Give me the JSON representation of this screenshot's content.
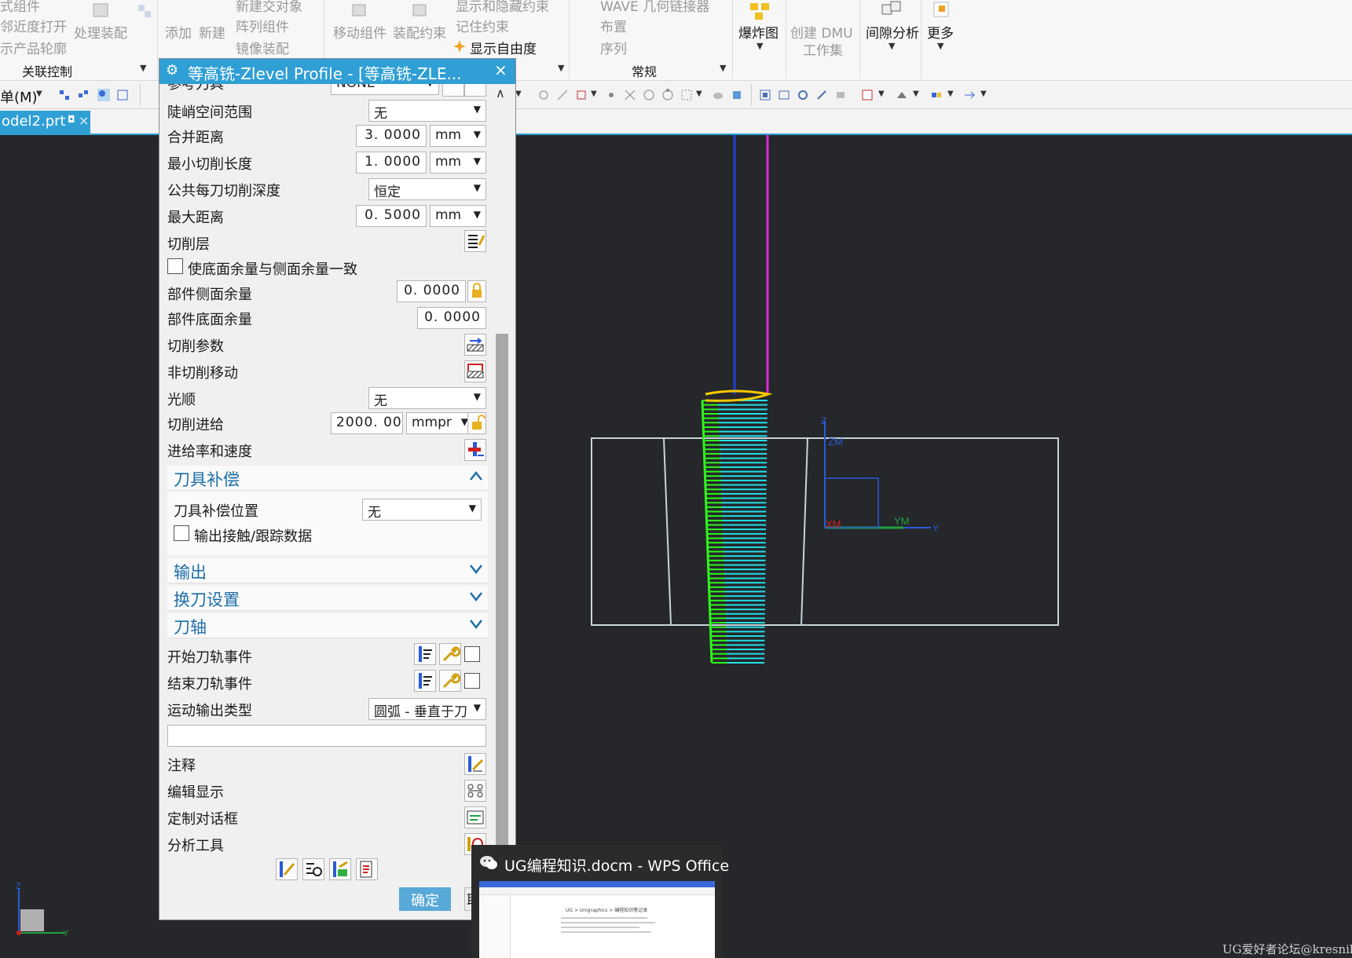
{
  "ribbon": {
    "left_items": [
      "式组件",
      "邻近度打开",
      "示产品轮廓"
    ],
    "process_assembly": "处理装配",
    "add": "添加",
    "new": "新建",
    "new_interaction_object": "新建交对象",
    "array_component": "阵列组件",
    "mirror_assembly": "镜像装配",
    "move_component": "移动组件",
    "assembly_constraint": "装配约束",
    "show_hide_constraint": "显示和隐藏约束",
    "remember_constraint": "记住约束",
    "show_dof": "显示自由度",
    "wave_linker": "WAVE 几何链接器",
    "layout": "布置",
    "sequence": "序列",
    "exploded_view": "爆炸图",
    "create_dmu": "创建 DMU",
    "workset": "工作集",
    "clearance_analysis": "间隙分析",
    "more": "更多",
    "group_association": "关联控制",
    "group_general": "常规"
  },
  "toolbar": {
    "menu_label": "单(M)"
  },
  "file_tab": {
    "name": "odel2.prt",
    "close": "×"
  },
  "dialog": {
    "title": "等高铣-Zlevel Profile - [等高铣-ZLE...",
    "close": "×",
    "ref_tool_label": "参考刀具",
    "ref_tool_value": "NONE",
    "steep_range_label": "陡峭空间范围",
    "steep_range_value": "无",
    "merge_dist_label": "合并距离",
    "merge_dist_value": "3. 0000",
    "min_cut_len_label": "最小切削长度",
    "min_cut_len_value": "1. 0000",
    "unit_mm": "mm",
    "common_depth_label": "公共每刀切削深度",
    "common_depth_value": "恒定",
    "max_dist_label": "最大距离",
    "max_dist_value": "0. 5000",
    "cut_levels_label": "切削层",
    "floor_same_as_side_label": "使底面余量与侧面余量一致",
    "part_side_stock_label": "部件侧面余量",
    "part_side_stock_value": "0. 0000",
    "part_floor_stock_label": "部件底面余量",
    "part_floor_stock_value": "0. 0000",
    "cutting_params_label": "切削参数",
    "non_cutting_label": "非切削移动",
    "smoothing_label": "光顺",
    "smoothing_value": "无",
    "cut_feed_label": "切削进给",
    "cut_feed_value": "2000. 000",
    "cut_feed_unit": "mmpr",
    "feeds_speeds_label": "进给率和速度",
    "section_tool_comp": "刀具补偿",
    "tool_comp_pos_label": "刀具补偿位置",
    "tool_comp_pos_value": "无",
    "output_contact_label": "输出接触/跟踪数据",
    "section_output": "输出",
    "section_tool_change": "换刀设置",
    "section_tool_axis": "刀轴",
    "start_event_label": "开始刀轨事件",
    "end_event_label": "结束刀轨事件",
    "motion_output_label": "运动输出类型",
    "motion_output_value": "圆弧 - 垂直于刀",
    "notes_label": "注释",
    "edit_display_label": "编辑显示",
    "custom_dialog_label": "定制对话框",
    "analysis_tools_label": "分析工具",
    "ok": "确定",
    "cancel_stub": "取"
  },
  "viewport": {
    "zm": "ZM",
    "ym": "YM",
    "xm": "XM",
    "y": "Y",
    "z": "Z",
    "triad_z": "Z",
    "triad_y": "Y"
  },
  "popup": {
    "title": "UG编程知识.docm - WPS Office",
    "thumb_breadcrumb": "UG > Unigraphics > 编程知识笔记本"
  },
  "watermark": "UG爱好者论坛@kresnik",
  "colors": {
    "accent": "#2f9fd5",
    "tool_blue": "#1f3fd6",
    "tool_magenta": "#e02ad8",
    "toolpath_cyan": "#22e0e8",
    "toolpath_green": "#2ef51c",
    "toolpath_yellow": "#f5c800",
    "part_outline": "#c8d4da"
  }
}
